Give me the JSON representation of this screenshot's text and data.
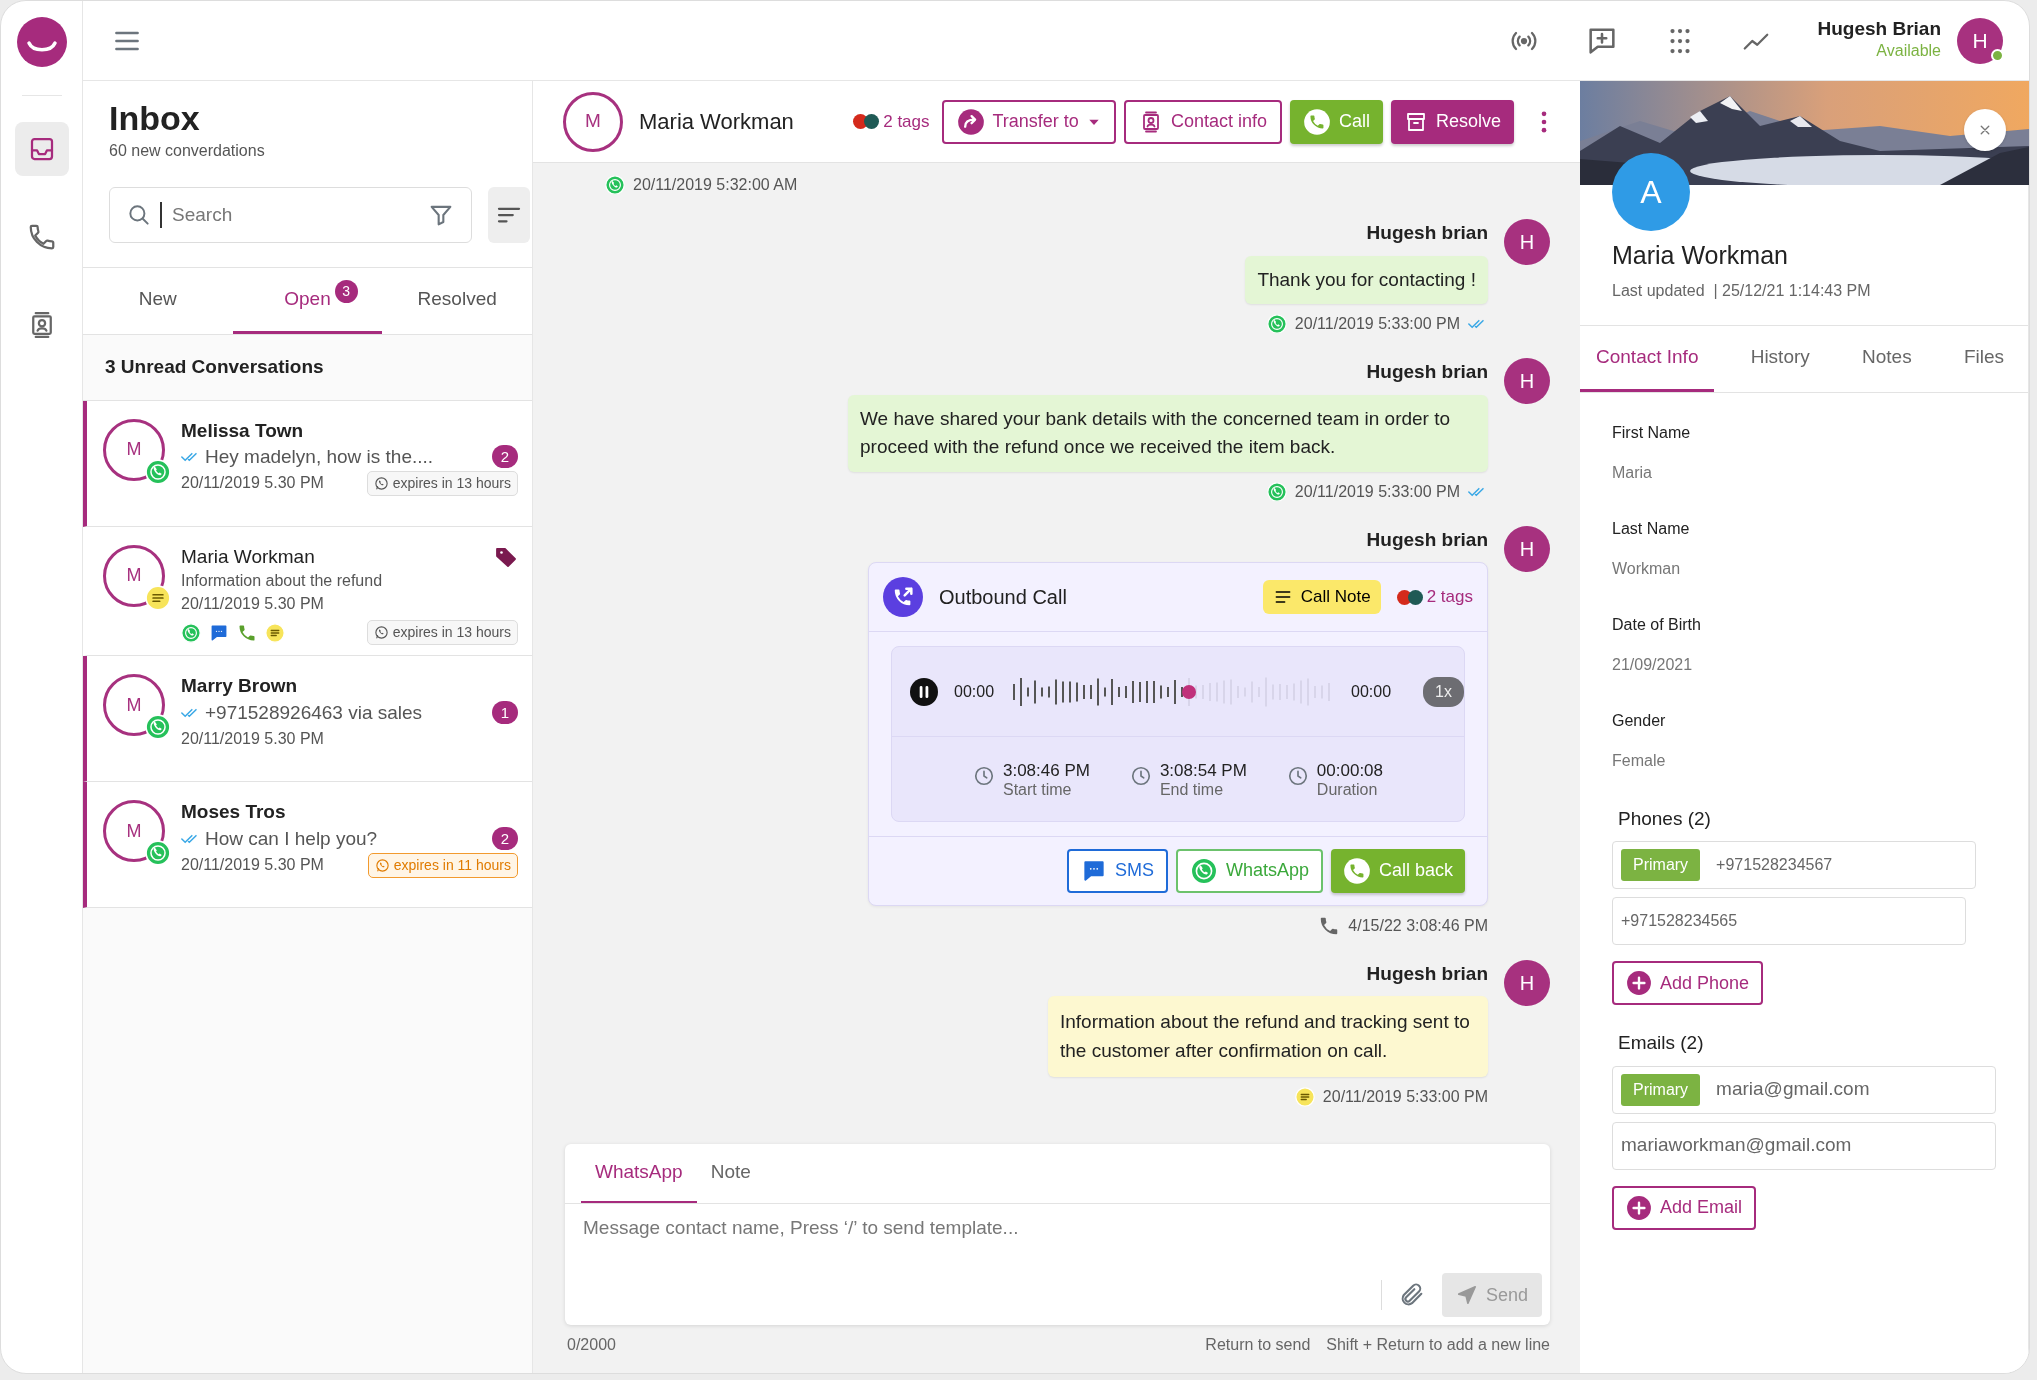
{
  "rail": {
    "items": [
      {
        "kind": "inbox",
        "selected": true
      },
      {
        "kind": "phone",
        "selected": false
      },
      {
        "kind": "contacts",
        "selected": false
      }
    ]
  },
  "topbar": {
    "user": {
      "name": "Hugesh Brian",
      "status": "Available",
      "initial": "H",
      "online": true
    }
  },
  "inbox": {
    "title": "Inbox",
    "subtitle": "60 new converdations",
    "search": {
      "placeholder": "Search"
    },
    "tabs": [
      {
        "label": "New",
        "selected": false
      },
      {
        "label": "Open",
        "count": "3",
        "selected": true
      },
      {
        "label": "Resolved",
        "selected": false
      }
    ],
    "unread_heading": "3 Unread Conversations",
    "conversations": [
      {
        "name": "Melissa Town",
        "initial": "M",
        "channel": {
          "kind": "whatsapp"
        },
        "unread": true,
        "read": true,
        "preview": "Hey madelyn, how is the....",
        "time": "20/11/2019 5.30 PM",
        "badge": "2",
        "expiry": "expires in 13 hours",
        "expiry_urgent": false,
        "tagged": false
      },
      {
        "name": "Maria Workman",
        "initial": "M",
        "channel": {
          "kind": "note"
        },
        "unread": false,
        "read": false,
        "preview": "Information about the refund",
        "time": "20/11/2019 5.30 PM",
        "expiry": "expires in 13 hours",
        "expiry_urgent": false,
        "tagged": true,
        "channels": [
          {
            "kind": "whatsapp"
          },
          {
            "kind": "sms"
          },
          {
            "kind": "phone"
          },
          {
            "kind": "note"
          }
        ]
      },
      {
        "name": "Marry Brown",
        "initial": "M",
        "channel": {
          "kind": "whatsapp"
        },
        "unread": true,
        "read": true,
        "preview": "+971528926463 via sales",
        "time": "20/11/2019 5.30 PM",
        "badge": "1",
        "tagged": false
      },
      {
        "name": "Moses Tros",
        "initial": "M",
        "channel": {
          "kind": "whatsapp"
        },
        "unread": true,
        "read": true,
        "preview": "How can I help you?",
        "time": "20/11/2019 5.30 PM",
        "badge": "2",
        "expiry": "expires in 11 hours",
        "expiry_urgent": true,
        "tagged": false
      }
    ]
  },
  "chat": {
    "header": {
      "initial": "M",
      "name": "Maria Workman",
      "tags": {
        "label": "2 tags",
        "dots": [
          {
            "color": "#d42a1c"
          },
          {
            "color": "#1f5a55"
          }
        ]
      },
      "buttons": [
        {
          "label": "Transfer to",
          "kind": "transfer"
        },
        {
          "label": "Contact info",
          "kind": "contact"
        },
        {
          "label": "Call",
          "kind": "call"
        },
        {
          "label": "Resolve",
          "kind": "resolve"
        }
      ]
    },
    "messages": [
      {
        "kind": "stamp",
        "channel": {
          "kind": "whatsapp"
        },
        "time": "20/11/2019 5:32:00 AM"
      },
      {
        "kind": "message",
        "sender": "Hugesh brian",
        "initial": "H",
        "text": "Thank you for contacting !",
        "channel": {
          "kind": "whatsapp"
        },
        "time": "20/11/2019 5:33:00 PM",
        "read": true
      },
      {
        "kind": "message",
        "sender": "Hugesh brian",
        "initial": "H",
        "text": "We have shared your bank details with the concerned team in order to proceed with the refund once we received the item back.",
        "channel": {
          "kind": "whatsapp"
        },
        "time": "20/11/2019 5:33:00 PM",
        "read": true
      },
      {
        "kind": "call",
        "sender": "Hugesh brian",
        "initial": "H",
        "title": "Outbound Call",
        "note_label": "Call Note",
        "tags": {
          "label": "2 tags",
          "dots": [
            {
              "color": "#d42a1c"
            },
            {
              "color": "#1f5a55"
            }
          ]
        },
        "player": {
          "elapsed": "00:00",
          "total": "00:00",
          "level": 0.55,
          "speed": "1x",
          "playing": true
        },
        "stats": [
          {
            "value": "3:08:46 PM",
            "label": "Start time"
          },
          {
            "value": "3:08:54 PM",
            "label": "End time"
          },
          {
            "value": "00:00:08",
            "label": "Duration"
          }
        ],
        "actions": [
          {
            "label": "SMS",
            "kind": "sms"
          },
          {
            "label": "WhatsApp",
            "kind": "whatsapp"
          },
          {
            "label": "Call back",
            "kind": "callback"
          }
        ],
        "channel": {
          "kind": "phone"
        },
        "time": "4/15/22 3:08:46 PM"
      },
      {
        "kind": "note",
        "sender": "Hugesh brian",
        "initial": "H",
        "text": "Information about the refund and tracking sent to the customer after confirmation on call.",
        "channel": {
          "kind": "note"
        },
        "time": "20/11/2019 5:33:00 PM"
      }
    ],
    "composer": {
      "tabs": [
        {
          "label": "WhatsApp",
          "selected": true
        },
        {
          "label": "Note",
          "selected": false
        }
      ],
      "placeholder": "Message contact name, Press ‘/’ to send template...",
      "send": "Send",
      "counter": "0/2000",
      "hints": [
        "Return to send",
        "Shift + Return to add a new line"
      ]
    }
  },
  "contact": {
    "initial": "A",
    "name": "Maria Workman",
    "updated": "Last updated  | 25/12/21 1:14:43 PM",
    "tabs": [
      {
        "label": "Contact Info",
        "selected": true
      },
      {
        "label": "History",
        "selected": false
      },
      {
        "label": "Notes",
        "selected": false
      },
      {
        "label": "Files",
        "selected": false
      }
    ],
    "fields": [
      {
        "label": "First Name",
        "value": "Maria"
      },
      {
        "label": "Last Name",
        "value": "Workman"
      },
      {
        "label": "Date of Birth",
        "value": "21/09/2021"
      },
      {
        "label": "Gender",
        "value": "Female"
      }
    ],
    "phones": {
      "heading": "Phones (2)",
      "items": [
        {
          "badge": "Primary",
          "value": "+971528234567"
        },
        {
          "value": "+971528234565"
        }
      ],
      "add": "Add Phone"
    },
    "emails": {
      "heading": "Emails (2)",
      "items": [
        {
          "badge": "Primary",
          "value": "maria@gmail.com"
        },
        {
          "value": "mariaworkman@gmail.com"
        }
      ],
      "add": "Add Email"
    }
  }
}
